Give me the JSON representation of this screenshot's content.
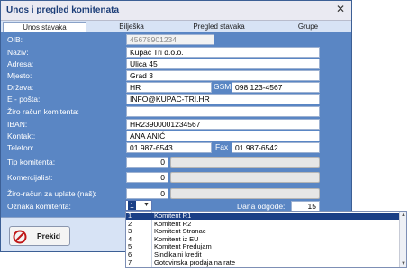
{
  "window": {
    "title": "Unos i pregled komitenata",
    "close_glyph": "✕"
  },
  "tabs": [
    {
      "label": "Unos stavaka",
      "active": true
    },
    {
      "label": "Bilješka",
      "active": false
    },
    {
      "label": "Pregled stavaka",
      "active": false
    },
    {
      "label": "Grupe",
      "active": false
    }
  ],
  "form": {
    "oib": {
      "label": "OIB:",
      "value": "45678901234"
    },
    "naziv": {
      "label": "Naziv:",
      "value": "Kupac Tri d.o.o."
    },
    "adresa": {
      "label": "Adresa:",
      "value": "Ulica 45"
    },
    "mjesto": {
      "label": "Mjesto:",
      "value": "Grad 3"
    },
    "drzava": {
      "label": "Država:",
      "value": "HR"
    },
    "gsm": {
      "label": "GSM",
      "value": "098 123-4567"
    },
    "email": {
      "label": "E - pošta:",
      "value": "INFO@KUPAC-TRI.HR"
    },
    "ziro": {
      "label": "Žiro račun komitenta:",
      "value": ""
    },
    "iban": {
      "label": "IBAN:",
      "value": "HR23900001234567"
    },
    "kontakt": {
      "label": "Kontakt:",
      "value": "ANA ANIĆ"
    },
    "telefon": {
      "label": "Telefon:",
      "value": "01 987-6543"
    },
    "fax": {
      "label": "Fax",
      "value": "01 987-6542"
    },
    "tip": {
      "label": "Tip komitenta:",
      "value": "0"
    },
    "komercijalist": {
      "label": "Komercijalist:",
      "value": "0"
    },
    "ziro_uplata": {
      "label": "Žiro-račun za uplate (naš):",
      "value": "0"
    },
    "oznaka": {
      "label": "Oznaka komitenta:",
      "value": "1"
    },
    "dana": {
      "label": "Dana odgode:",
      "value": "15"
    }
  },
  "buttons": {
    "cancel": "Prekid"
  },
  "dropdown": {
    "options": [
      {
        "code": "1",
        "name": "Komitent R1",
        "selected": true
      },
      {
        "code": "2",
        "name": "Komitent R2",
        "selected": false
      },
      {
        "code": "3",
        "name": "Komitent Stranac",
        "selected": false
      },
      {
        "code": "4",
        "name": "Komitent iz EU",
        "selected": false
      },
      {
        "code": "5",
        "name": "Komitent Predujam",
        "selected": false
      },
      {
        "code": "6",
        "name": "Sindikalni kredit",
        "selected": false
      },
      {
        "code": "7",
        "name": "Gotovinska prodaja na rate",
        "selected": false
      }
    ]
  },
  "colors": {
    "form_bg": "#5a86c4",
    "selected_row": "#1a3f86",
    "tab_bg": "#d7e3f5"
  }
}
